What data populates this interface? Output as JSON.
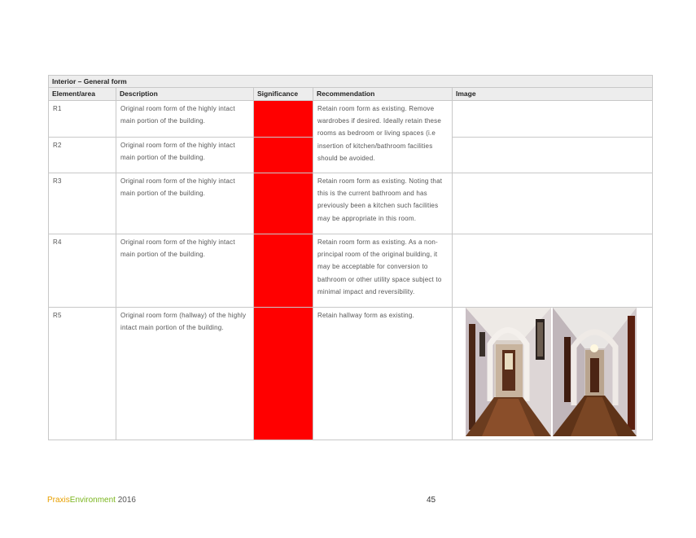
{
  "section_title": "Interior – General form",
  "columns": {
    "element": "Element/area",
    "description": "Description",
    "significance": "Significance",
    "recommendation": "Recommendation",
    "image": "Image"
  },
  "rows": [
    {
      "element": "R1",
      "description": "Original room form of the highly intact main portion of the building.",
      "recommendation": "Retain room form as existing. Remove wardrobes if desired. Ideally retain these rooms as bedroom or living spaces (i.e insertion of kitchen/bathroom facilities should be avoided."
    },
    {
      "element": "R2",
      "description": "Original room form of the highly intact main portion of the building."
    },
    {
      "element": "R3",
      "description": "Original room form of the highly intact main portion of the building.",
      "recommendation": "Retain room form as existing. Noting that this is the current bathroom and has previously been a kitchen such facilities may be appropriate in this room."
    },
    {
      "element": "R4",
      "description": "Original room form of the highly intact main portion of the building.",
      "recommendation": "Retain room form as existing. As a non-principal room of the original building, it may be acceptable for conversion to bathroom or other utility space subject to minimal impact and reversibility."
    },
    {
      "element": "R5",
      "description": "Original room form (hallway) of the highly intact main portion of the building.",
      "recommendation": "Retain hallway form as existing."
    }
  ],
  "colors": {
    "significance_high": "#ff0000",
    "header_bg": "#ededed",
    "brand_praxis": "#e8a000",
    "brand_environment": "#7ab51d"
  },
  "footer": {
    "brand_praxis": "Praxis",
    "brand_environment": "Environment",
    "year": "2016",
    "page_number": "45"
  }
}
